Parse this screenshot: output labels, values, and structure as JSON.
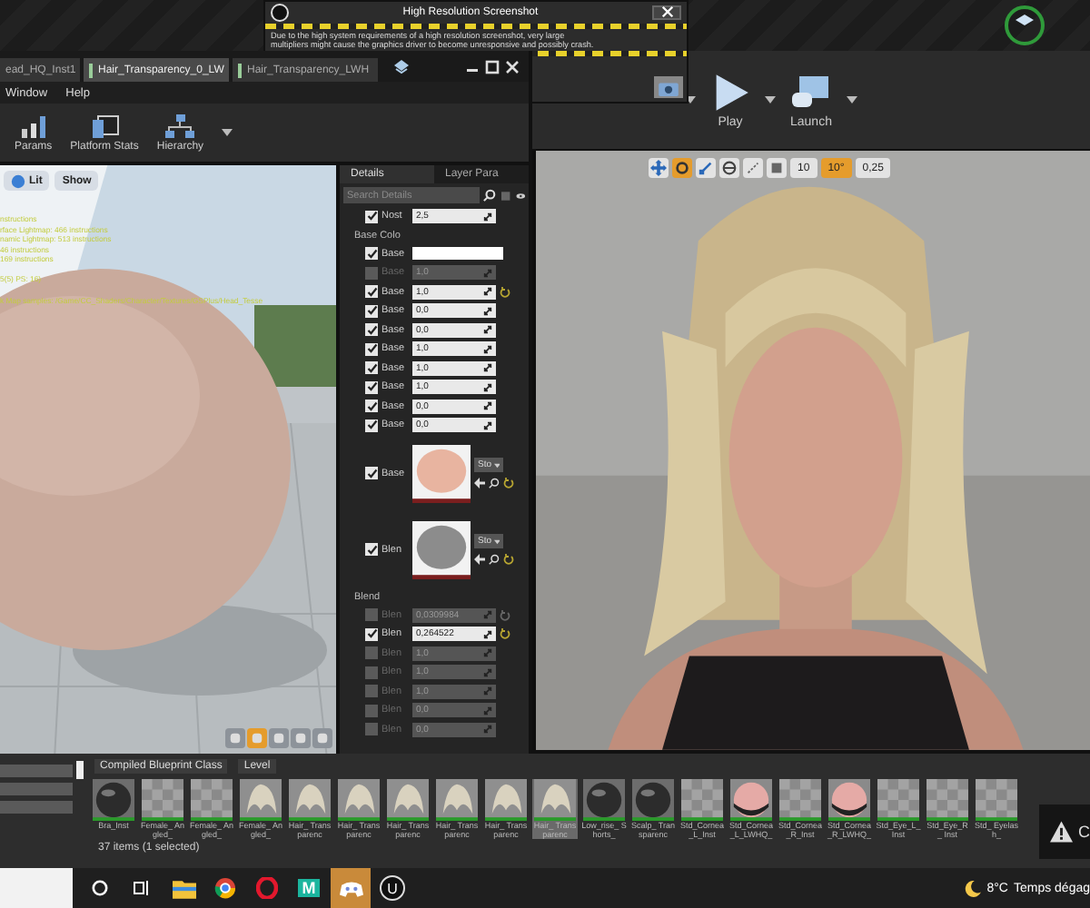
{
  "dialog": {
    "title": "High Resolution Screenshot",
    "lines": [
      "Due to the high system requirements of a high resolution screenshot, very large",
      "multipliers might cause the graphics driver to become unresponsive and possibly crash."
    ]
  },
  "editor_toolbar": [
    {
      "label": "Play",
      "kind": "play"
    },
    {
      "label": "Launch",
      "kind": "launch"
    }
  ],
  "viewport_snaps": [
    {
      "value": "10",
      "on": false
    },
    {
      "value": "10°",
      "on": true
    },
    {
      "value": "0,25",
      "on": false
    }
  ],
  "material_window": {
    "tabs": [
      {
        "label": "ead_HQ_Inst1",
        "selected": false
      },
      {
        "label": "Hair_Transparency_0_LW",
        "selected": true
      },
      {
        "label": "Hair_Transparency_LWH",
        "selected": false
      }
    ],
    "menu": [
      "Window",
      "Help"
    ],
    "toolbar": [
      {
        "label": "Params",
        "kind": "params"
      },
      {
        "label": "Platform Stats",
        "kind": "stats"
      },
      {
        "label": "Hierarchy",
        "kind": "hierarchy"
      }
    ],
    "viewport": {
      "buttons": [
        "Lit",
        "Show"
      ],
      "stats": [
        "nstructions",
        "rface Lightmap: 466 instructions",
        "namic Lightmap: 513 instructions",
        "46 instructions",
        "169 instructions",
        "5(5) PS: 16)",
        "k Map samples: /Game/CC_Shaders/Character/Textures/GSPlus/Head_Tesse"
      ],
      "corner_buttons": [
        {
          "selected": false
        },
        {
          "selected": true
        },
        {
          "selected": false
        },
        {
          "selected": false
        },
        {
          "selected": false
        }
      ]
    },
    "details": {
      "tabs": [
        {
          "label": "Details",
          "selected": true
        },
        {
          "label": "Layer Para",
          "selected": false
        }
      ],
      "search": {
        "placeholder": "Search Details"
      },
      "rows": [
        {
          "kind": "slider",
          "label": "Nost",
          "value": "2,5",
          "checked": true,
          "reset": false
        },
        {
          "kind": "section",
          "label": "Base Colo"
        },
        {
          "kind": "color",
          "label": "Base",
          "checked": true
        },
        {
          "kind": "slider",
          "label": "Base",
          "value": "1,0",
          "checked": false,
          "reset": false
        },
        {
          "kind": "slider",
          "label": "Base",
          "value": "1,0",
          "checked": true,
          "reset": true
        },
        {
          "kind": "slider",
          "label": "Base",
          "value": "0,0",
          "checked": true,
          "reset": false
        },
        {
          "kind": "slider",
          "label": "Base",
          "value": "0,0",
          "checked": true,
          "reset": false
        },
        {
          "kind": "slider",
          "label": "Base",
          "value": "1,0",
          "checked": true,
          "reset": false
        },
        {
          "kind": "slider",
          "label": "Base",
          "value": "1,0",
          "checked": true,
          "reset": false
        },
        {
          "kind": "slider",
          "label": "Base",
          "value": "1,0",
          "checked": true,
          "reset": false
        },
        {
          "kind": "slider",
          "label": "Base",
          "value": "0,0",
          "checked": true,
          "reset": false
        },
        {
          "kind": "slider",
          "label": "Base",
          "value": "0,0",
          "checked": true,
          "reset": false
        },
        {
          "kind": "texture",
          "label": "Base",
          "checked": true,
          "source": "Sto"
        },
        {
          "kind": "texture",
          "label": "Blen",
          "checked": true,
          "source": "Sto"
        },
        {
          "kind": "section",
          "label": "Blend"
        },
        {
          "kind": "slider",
          "label": "Blen",
          "value": "0,0309984",
          "checked": false,
          "reset": true
        },
        {
          "kind": "slider",
          "label": "Blen",
          "value": "0,264522",
          "checked": true,
          "reset": true
        },
        {
          "kind": "slider",
          "label": "Blen",
          "value": "1,0",
          "checked": false,
          "reset": false
        },
        {
          "kind": "slider",
          "label": "Blen",
          "value": "1,0",
          "checked": false,
          "reset": false
        },
        {
          "kind": "slider",
          "label": "Blen",
          "value": "1,0",
          "checked": false,
          "reset": false
        },
        {
          "kind": "slider",
          "label": "Blen",
          "value": "0,0",
          "checked": false,
          "reset": false
        },
        {
          "kind": "slider",
          "label": "Blen",
          "value": "0,0",
          "checked": false,
          "reset": false
        }
      ]
    }
  },
  "content_browser": {
    "filters": [
      "Compiled Blueprint Class",
      "Level"
    ],
    "assets": [
      {
        "name": "Bra_Inst",
        "kind": "dark-sphere",
        "selected": false
      },
      {
        "name": "Female_ Angled_",
        "kind": "checker",
        "selected": false
      },
      {
        "name": "Female_ Angled_",
        "kind": "checker",
        "selected": false
      },
      {
        "name": "Female_ Angled_",
        "kind": "hair",
        "selected": false
      },
      {
        "name": "Hair_ Transparenc",
        "kind": "hair",
        "selected": false
      },
      {
        "name": "Hair_ Transparenc",
        "kind": "hair",
        "selected": false
      },
      {
        "name": "Hair_ Transparenc",
        "kind": "hair",
        "selected": false
      },
      {
        "name": "Hair_ Transparenc",
        "kind": "hair",
        "selected": false
      },
      {
        "name": "Hair_ Transparenc",
        "kind": "hair",
        "selected": false
      },
      {
        "name": "Hair_ Transparenc",
        "kind": "hair",
        "selected": true
      },
      {
        "name": "Low_rise_ Shorts_",
        "kind": "dark-sphere",
        "selected": false
      },
      {
        "name": "Scalp_ Transparenc",
        "kind": "dark-sphere",
        "selected": false
      },
      {
        "name": "Std_Cornea _L_Inst",
        "kind": "checker",
        "selected": false
      },
      {
        "name": "Std_Cornea _L_LWHQ_",
        "kind": "pink-sphere",
        "selected": false
      },
      {
        "name": "Std_Cornea _R_Inst",
        "kind": "checker",
        "selected": false
      },
      {
        "name": "Std_Cornea _R_LWHQ_",
        "kind": "pink-sphere",
        "selected": false
      },
      {
        "name": "Std_Eye_L_ Inst",
        "kind": "checker",
        "selected": false
      },
      {
        "name": "Std_Eye_R_ Inst",
        "kind": "checker",
        "selected": false
      },
      {
        "name": "Std_ Eyelash_",
        "kind": "checker",
        "selected": false
      }
    ],
    "status": "37 items (1 selected)"
  },
  "toast": {
    "text": "C"
  },
  "taskbar": {
    "apps": [
      {
        "kind": "search",
        "selected": false
      },
      {
        "kind": "taskview",
        "selected": false
      },
      {
        "kind": "folder",
        "selected": false
      },
      {
        "kind": "wheel",
        "selected": false
      },
      {
        "kind": "ring",
        "selected": false
      },
      {
        "kind": "letter",
        "label": "M",
        "selected": false
      },
      {
        "kind": "controller",
        "selected": true
      },
      {
        "kind": "badge",
        "label": "U",
        "selected": false
      }
    ],
    "temperature": "8°C",
    "weather": "Temps dégag"
  }
}
